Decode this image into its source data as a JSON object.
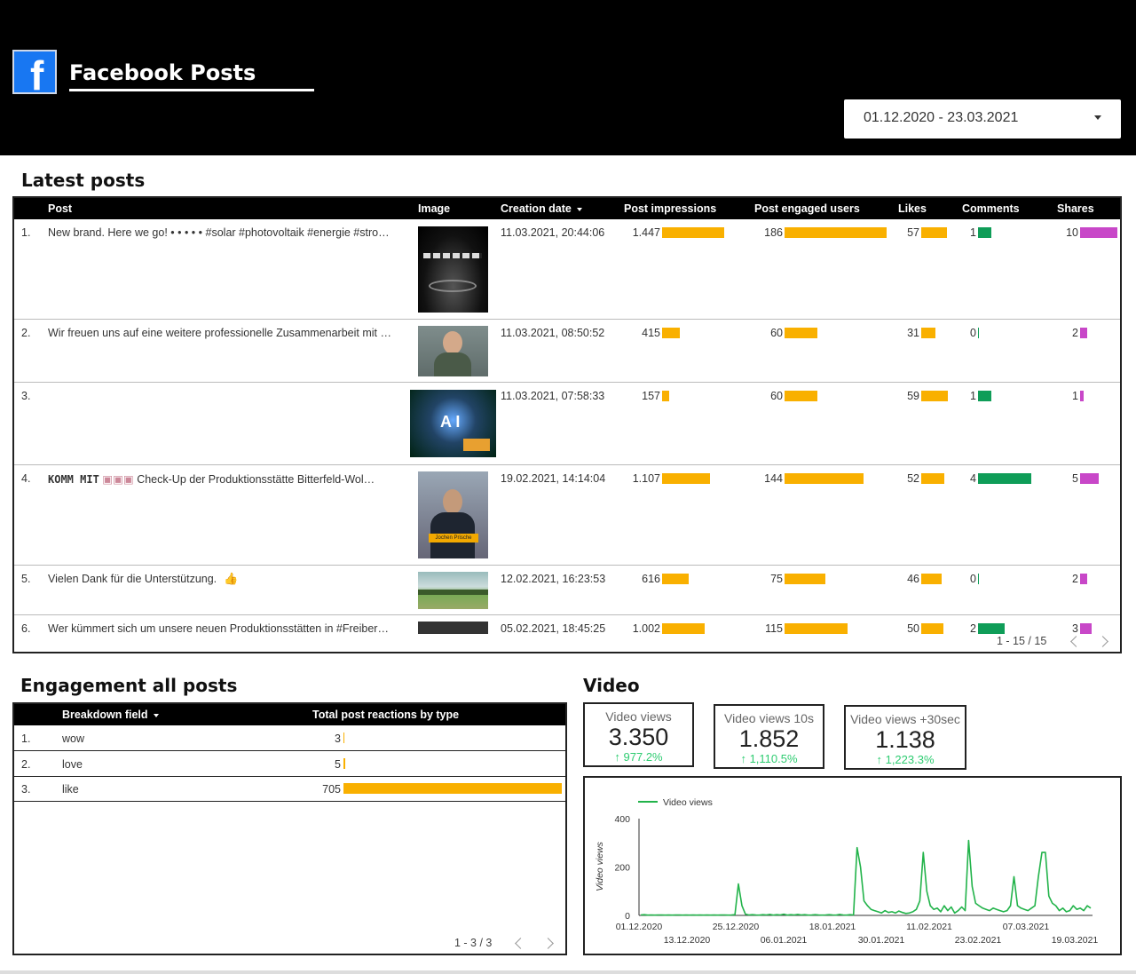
{
  "header": {
    "logo_letter": "f",
    "title": "Facebook Posts",
    "date_range": "01.12.2020 - 23.03.2021"
  },
  "latest_posts": {
    "title": "Latest posts",
    "columns": [
      "Post",
      "Image",
      "Creation date",
      "Post impressions",
      "Post engaged users",
      "Likes",
      "Comments",
      "Shares"
    ],
    "rows": [
      {
        "idx": "1.",
        "post": "New brand. Here we go! • • • • • #solar #photovoltaik #energie #stro…",
        "date": "11.03.2021, 20:44:06",
        "impressions": "1.447",
        "engaged": "186",
        "likes": "57",
        "comments": "1",
        "shares": "10"
      },
      {
        "idx": "2.",
        "post": "Wir freuen uns auf eine weitere professionelle Zusammenarbeit mit …",
        "date": "11.03.2021, 08:50:52",
        "impressions": "415",
        "engaged": "60",
        "likes": "31",
        "comments": "0",
        "shares": "2"
      },
      {
        "idx": "3.",
        "post": "",
        "date": "11.03.2021, 07:58:33",
        "impressions": "157",
        "engaged": "60",
        "likes": "59",
        "comments": "1",
        "shares": "1"
      },
      {
        "idx": "4.",
        "post_bold": "KOMM MIT",
        "post": "Check-Up der Produktionsstätte Bitterfeld-Wol…",
        "date": "19.02.2021, 14:14:04",
        "impressions": "1.107",
        "engaged": "144",
        "likes": "52",
        "comments": "4",
        "shares": "5"
      },
      {
        "idx": "5.",
        "post": "Vielen Dank für die Unterstützung.",
        "date": "12.02.2021, 16:23:53",
        "impressions": "616",
        "engaged": "75",
        "likes": "46",
        "comments": "0",
        "shares": "2"
      },
      {
        "idx": "6.",
        "post": "Wer kümmert sich um unsere neuen Produktionsstätten in #Freiber…",
        "date": "05.02.2021, 18:45:25",
        "impressions": "1.002",
        "engaged": "115",
        "likes": "50",
        "comments": "2",
        "shares": "3"
      }
    ],
    "thumb_captions": {
      "row4": "Jochen Prische"
    },
    "pager": "1 - 15 / 15"
  },
  "engagement": {
    "title": "Engagement all posts",
    "columns": [
      "Breakdown field",
      "Total post reactions by type"
    ],
    "rows": [
      {
        "idx": "1.",
        "field": "wow",
        "value": "3"
      },
      {
        "idx": "2.",
        "field": "love",
        "value": "5"
      },
      {
        "idx": "3.",
        "field": "like",
        "value": "705"
      }
    ],
    "pager": "1 - 3 / 3"
  },
  "video": {
    "title": "Video",
    "kpis": [
      {
        "label": "Video views",
        "value": "3.350",
        "change": "977.2%"
      },
      {
        "label": "Video views 10s",
        "value": "1.852",
        "change": "1,110.5%"
      },
      {
        "label": "Video views +30sec",
        "value": "1.138",
        "change": "1,223.3%"
      }
    ]
  },
  "colors": {
    "impressions": "#f9b000",
    "comments": "#0f9d58",
    "shares": "#c847c8",
    "line": "#22b34a",
    "brand": "#1877f2"
  },
  "chart_data": {
    "type": "line",
    "legend": [
      "Video views"
    ],
    "ylabel": "Video views",
    "ylim": [
      0,
      400
    ],
    "yticks": [
      "400",
      "200",
      "0"
    ],
    "xticks_top": [
      "01.12.2020",
      "25.12.2020",
      "18.01.2021",
      "11.02.2021",
      "07.03.2021"
    ],
    "xticks_bottom": [
      "13.12.2020",
      "06.01.2021",
      "30.01.2021",
      "23.02.2021",
      "19.03.2021"
    ],
    "series": [
      {
        "name": "Video views",
        "values": [
          2,
          3,
          1,
          2,
          1,
          2,
          2,
          1,
          2,
          1,
          2,
          2,
          1,
          2,
          1,
          2,
          1,
          2,
          1,
          2,
          1,
          2,
          1,
          2,
          2,
          1,
          2,
          3,
          130,
          40,
          5,
          2,
          3,
          2,
          1,
          3,
          2,
          4,
          1,
          3,
          2,
          5,
          1,
          3,
          2,
          4,
          2,
          3,
          1,
          2,
          3,
          2,
          1,
          2,
          3,
          2,
          1,
          4,
          2,
          1,
          3,
          2,
          280,
          200,
          60,
          40,
          25,
          20,
          15,
          10,
          20,
          12,
          15,
          10,
          18,
          12,
          8,
          10,
          15,
          25,
          60,
          260,
          100,
          40,
          25,
          30,
          15,
          40,
          20,
          35,
          10,
          20,
          35,
          20,
          310,
          120,
          50,
          40,
          30,
          25,
          20,
          30,
          25,
          20,
          15,
          20,
          40,
          160,
          40,
          30,
          25,
          20,
          30,
          40,
          160,
          260,
          260,
          80,
          50,
          40,
          20,
          30,
          15,
          20,
          40,
          25,
          30,
          20,
          40,
          30
        ]
      }
    ]
  }
}
